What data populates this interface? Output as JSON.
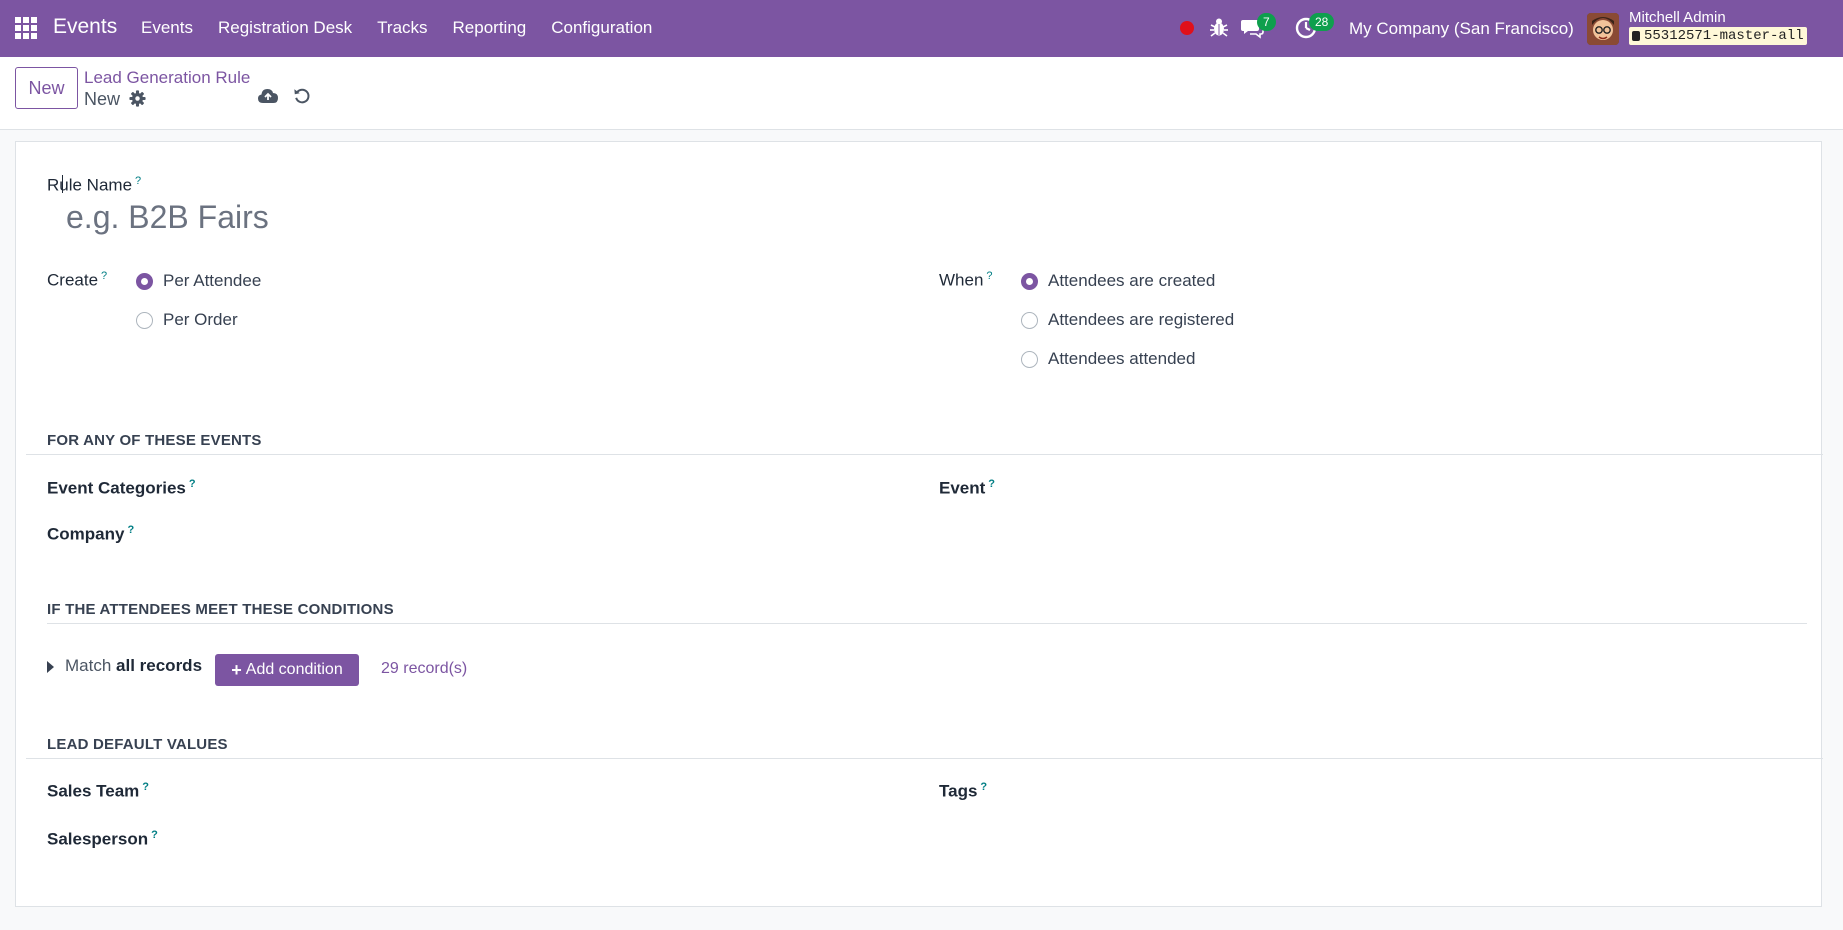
{
  "navbar": {
    "brand": "Events",
    "menu": [
      "Events",
      "Registration Desk",
      "Tracks",
      "Reporting",
      "Configuration"
    ],
    "messages_count": "7",
    "activities_count": "28",
    "company": "My Company (San Francisco)",
    "user_name": "Mitchell Admin",
    "db_name": "55312571-master-all",
    "color": "#7c55a2"
  },
  "control": {
    "new_label": "New",
    "breadcrumb": "Lead Generation Rule",
    "record_name": "New"
  },
  "form": {
    "rule_name_label": "Rule Name",
    "rule_name_placeholder": "e.g. B2B Fairs",
    "help_mark": "?",
    "create_label": "Create",
    "create_options": [
      "Per Attendee",
      "Per Order"
    ],
    "create_selected": "Per Attendee",
    "when_label": "When",
    "when_options": [
      "Attendees are created",
      "Attendees are registered",
      "Attendees attended"
    ],
    "when_selected": "Attendees are created",
    "section_events": "FOR ANY OF THESE EVENTS",
    "event_categories_label": "Event Categories",
    "event_label": "Event",
    "company_label": "Company",
    "section_conditions": "IF THE ATTENDEES MEET THESE CONDITIONS",
    "match_prefix": "Match",
    "match_scope": "all records",
    "add_condition": "Add condition",
    "records_count": "29 record(s)",
    "section_defaults": "LEAD DEFAULT VALUES",
    "sales_team_label": "Sales Team",
    "tags_label": "Tags",
    "salesperson_label": "Salesperson"
  }
}
